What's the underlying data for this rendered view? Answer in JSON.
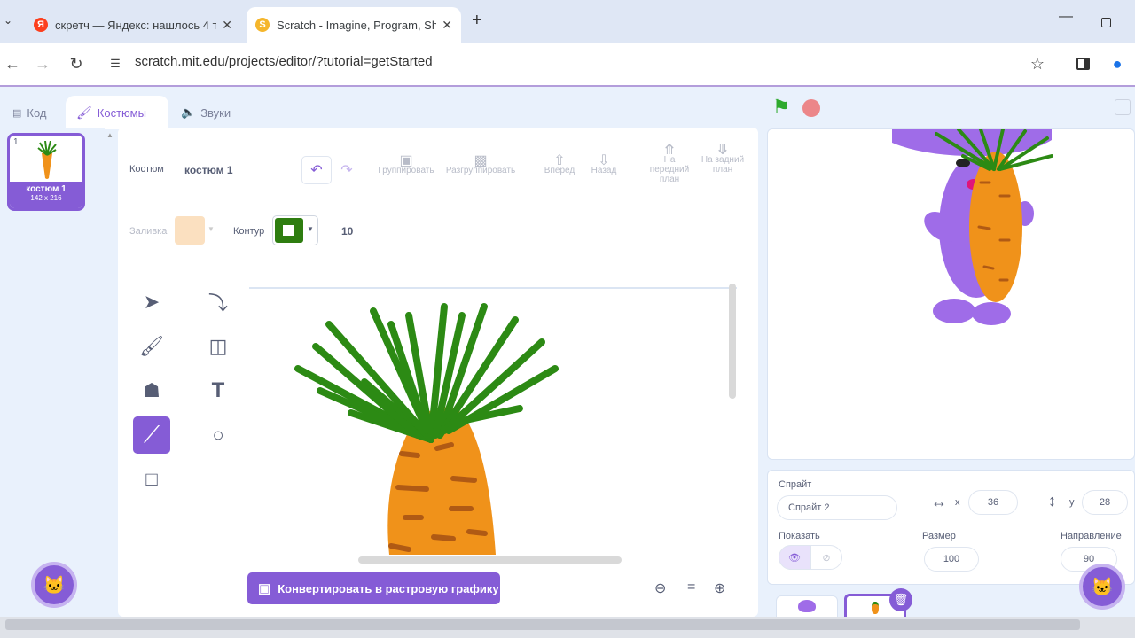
{
  "browser": {
    "tabs": [
      {
        "title": "скретч — Яндекс: нашлось 4 т",
        "favicon": "Я"
      },
      {
        "title": "Scratch - Imagine, Program, Sh",
        "favicon": "S"
      }
    ],
    "new_tab": "+",
    "url": "scratch.mit.edu/projects/editor/?tutorial=getStarted"
  },
  "editor_tabs": {
    "code": "Код",
    "costumes": "Костюмы",
    "sounds": "Звуки"
  },
  "costume_list": {
    "index": "1",
    "name": "костюм 1",
    "size": "142 x 216"
  },
  "paint": {
    "costume_label": "Костюм",
    "costume_name": "костюм 1",
    "group": "Группировать",
    "ungroup": "Разгруппировать",
    "forward": "Вперед",
    "backward": "Назад",
    "front": "На передний план",
    "back": "На задний план",
    "fill_label": "Заливка",
    "outline_label": "Контур",
    "outline_width": "10",
    "convert_button": "Конвертировать в растровую графику",
    "zoom_reset": "="
  },
  "sprite": {
    "label": "Спрайт",
    "name": "Спрайт 2",
    "x_label": "x",
    "x": "36",
    "y_label": "y",
    "y": "28",
    "show_label": "Показать",
    "size_label": "Размер",
    "size": "100",
    "direction_label": "Направление",
    "direction": "90"
  },
  "colors": {
    "accent": "#855cd6",
    "fill": "#fbe0c0",
    "outline": "#2e7d10",
    "carrot": "#f0921a",
    "leaf": "#2c8a14"
  }
}
